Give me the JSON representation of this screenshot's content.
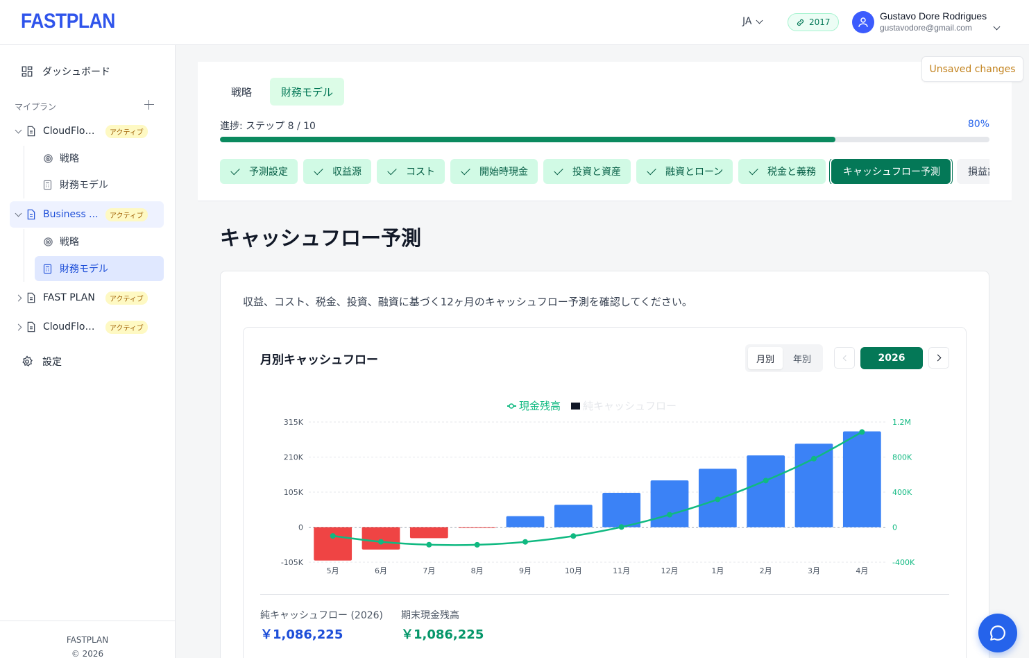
{
  "header": {
    "logo": "FASTPLAN",
    "language": "JA",
    "year_badge": "2017",
    "user_name": "Gustavo Dore Rodrigues",
    "user_email": "gustavodore@gmail.com"
  },
  "sidebar": {
    "dashboard": "ダッシュボード",
    "section_label": "マイプラン",
    "plans": [
      {
        "title": "CloudFlow...",
        "status": "アクティブ",
        "expanded": true,
        "active": false,
        "children": [
          "戦略",
          "財務モデル"
        ]
      },
      {
        "title": "Business ...",
        "status": "アクティブ",
        "expanded": true,
        "active": true,
        "children": [
          "戦略",
          "財務モデル"
        ]
      },
      {
        "title": "FAST PLAN",
        "status": "アクティブ",
        "expanded": false,
        "active": false
      },
      {
        "title": "CloudFlow...",
        "status": "アクティブ",
        "expanded": false,
        "active": false
      }
    ],
    "settings": "設定",
    "footer_brand": "FASTPLAN",
    "footer_copy": "© 2026"
  },
  "main": {
    "tabs": [
      "戦略",
      "財務モデル"
    ],
    "active_tab": 1,
    "unsaved": "Unsaved changes",
    "progress_label": "進捗: ステップ 8 / 10",
    "progress_percent": "80%",
    "progress_value": 0.8,
    "steps": [
      "予測設定",
      "収益源",
      "コスト",
      "開始時現金",
      "投資と資産",
      "融資とローン",
      "税金と義務",
      "キャッシュフロー予測",
      "損益計算書"
    ],
    "current_step": 7,
    "page_title": "キャッシュフロー予測",
    "description": "収益、コスト、税金、投資、融資に基づく12ヶ月のキャッシュフロー予測を確認してください。",
    "chart_card": {
      "title": "月別キャッシュフロー",
      "view_monthly": "月別",
      "view_yearly": "年別",
      "year": "2026"
    },
    "summary": {
      "net_label": "純キャッシュフロー (2026)",
      "net_value": "￥1,086,225",
      "ending_label": "期末現金残高",
      "ending_value": "￥1,086,225"
    }
  },
  "colors": {
    "positive_bar": "#3b82f6",
    "negative_bar": "#ef4444",
    "cash_line": "#10b981",
    "brand": "#2f54eb",
    "accent_green": "#047857"
  },
  "chart_data": {
    "type": "bar",
    "categories": [
      "5月",
      "6月",
      "7月",
      "8月",
      "9月",
      "10月",
      "11月",
      "12月",
      "1月",
      "2月",
      "3月",
      "4月"
    ],
    "series": [
      {
        "name": "純キャッシュフロー",
        "type": "bar",
        "axis": "left",
        "values": [
          -100000,
          -67000,
          -33000,
          -1000,
          33000,
          67000,
          103000,
          140000,
          175000,
          215000,
          250000,
          287000
        ]
      },
      {
        "name": "現金残高",
        "type": "line",
        "axis": "right",
        "values": [
          -100000,
          -167000,
          -200000,
          -201000,
          -168000,
          -101000,
          2000,
          142000,
          317000,
          532000,
          782000,
          1086225
        ]
      }
    ],
    "left_ticks": [
      "315K",
      "210K",
      "105K",
      "0",
      "-105K"
    ],
    "right_ticks": [
      "1.2M",
      "800K",
      "400K",
      "0",
      "-400K"
    ],
    "ylim_left": [
      -105000,
      315000
    ],
    "ylim_right": [
      -400000,
      1200000
    ],
    "legend_position": "top-center",
    "grid": "dashed-horizontal"
  }
}
